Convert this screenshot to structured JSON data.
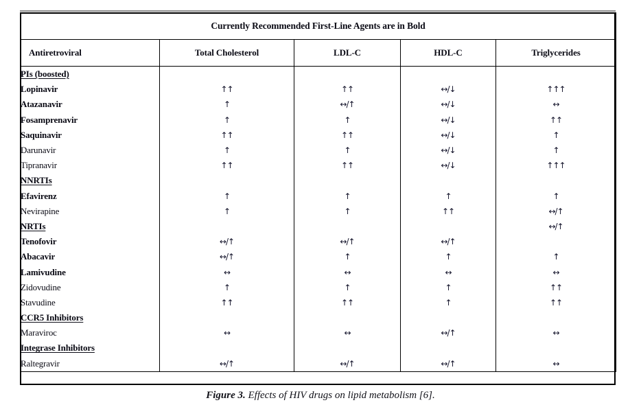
{
  "figure": {
    "number_label": "Figure 3.",
    "caption_text": "Effects of HIV drugs on lipid metabolism [6]."
  },
  "table": {
    "title": "Currently Recommended First-Line Agents are in Bold",
    "columns": [
      "Antiretroviral",
      "Total Cholesterol",
      "LDL-C",
      "HDL-C",
      "Triglycerides"
    ],
    "rows": [
      {
        "drug": "PIs (boosted)",
        "style": "class-header",
        "tc": "",
        "ldl": "",
        "hdl": "",
        "tg": ""
      },
      {
        "drug": "Lopinavir",
        "style": "bold",
        "tc": "↑↑",
        "ldl": "↑↑",
        "hdl": "↔/↓",
        "tg": "↑↑↑"
      },
      {
        "drug": "Atazanavir",
        "style": "bold",
        "tc": "↑",
        "ldl": "↔/↑",
        "hdl": "↔/↓",
        "tg": "↔"
      },
      {
        "drug": "Fosamprenavir",
        "style": "bold",
        "tc": "↑",
        "ldl": "↑",
        "hdl": "↔/↓",
        "tg": "↑↑"
      },
      {
        "drug": "Saquinavir",
        "style": "bold",
        "tc": "↑↑",
        "ldl": "↑↑",
        "hdl": "↔/↓",
        "tg": "↑"
      },
      {
        "drug": "Darunavir",
        "style": "normal",
        "tc": "↑",
        "ldl": "↑",
        "hdl": "↔/↓",
        "tg": "↑"
      },
      {
        "drug": "Tipranavir",
        "style": "normal",
        "tc": "↑↑",
        "ldl": "↑↑",
        "hdl": "↔/↓",
        "tg": "↑↑↑"
      },
      {
        "drug": "NNRTIs",
        "style": "class-header",
        "tc": "",
        "ldl": "",
        "hdl": "",
        "tg": ""
      },
      {
        "drug": "Efavirenz",
        "style": "bold",
        "tc": "↑",
        "ldl": "↑",
        "hdl": "↑",
        "tg": "↑"
      },
      {
        "drug": "Nevirapine",
        "style": "normal",
        "tc": "↑",
        "ldl": "↑",
        "hdl": "↑↑",
        "tg": "↔/↑"
      },
      {
        "drug": "NRTIs",
        "style": "class-header",
        "tc": "",
        "ldl": "",
        "hdl": "",
        "tg": "↔/↑"
      },
      {
        "drug": "Tenofovir",
        "style": "bold",
        "tc": "↔/↑",
        "ldl": "↔/↑",
        "hdl": "↔/↑",
        "tg": ""
      },
      {
        "drug": "Abacavir",
        "style": "bold",
        "tc": "↔/↑",
        "ldl": "↑",
        "hdl": "↑",
        "tg": "↑"
      },
      {
        "drug": "Lamivudine",
        "style": "bold",
        "tc": "↔",
        "ldl": "↔",
        "hdl": "↔",
        "tg": "↔"
      },
      {
        "drug": "Zidovudine",
        "style": "normal",
        "tc": "↑",
        "ldl": "↑",
        "hdl": "↑",
        "tg": "↑↑"
      },
      {
        "drug": "Stavudine",
        "style": "normal",
        "tc": "↑↑",
        "ldl": "↑↑",
        "hdl": "↑",
        "tg": "↑↑"
      },
      {
        "drug": "CCR5 Inhibitors",
        "style": "class-header",
        "tc": "",
        "ldl": "",
        "hdl": "",
        "tg": ""
      },
      {
        "drug": "Maraviroc",
        "style": "normal",
        "tc": "↔",
        "ldl": "↔",
        "hdl": "↔/↑",
        "tg": "↔"
      },
      {
        "drug": "Integrase Inhibitors",
        "style": "class-header",
        "tc": "",
        "ldl": "",
        "hdl": "",
        "tg": ""
      },
      {
        "drug": "Raltegravir",
        "style": "normal",
        "tc": "↔/↑",
        "ldl": "↔/↑",
        "hdl": "↔/↑",
        "tg": "↔"
      }
    ]
  }
}
